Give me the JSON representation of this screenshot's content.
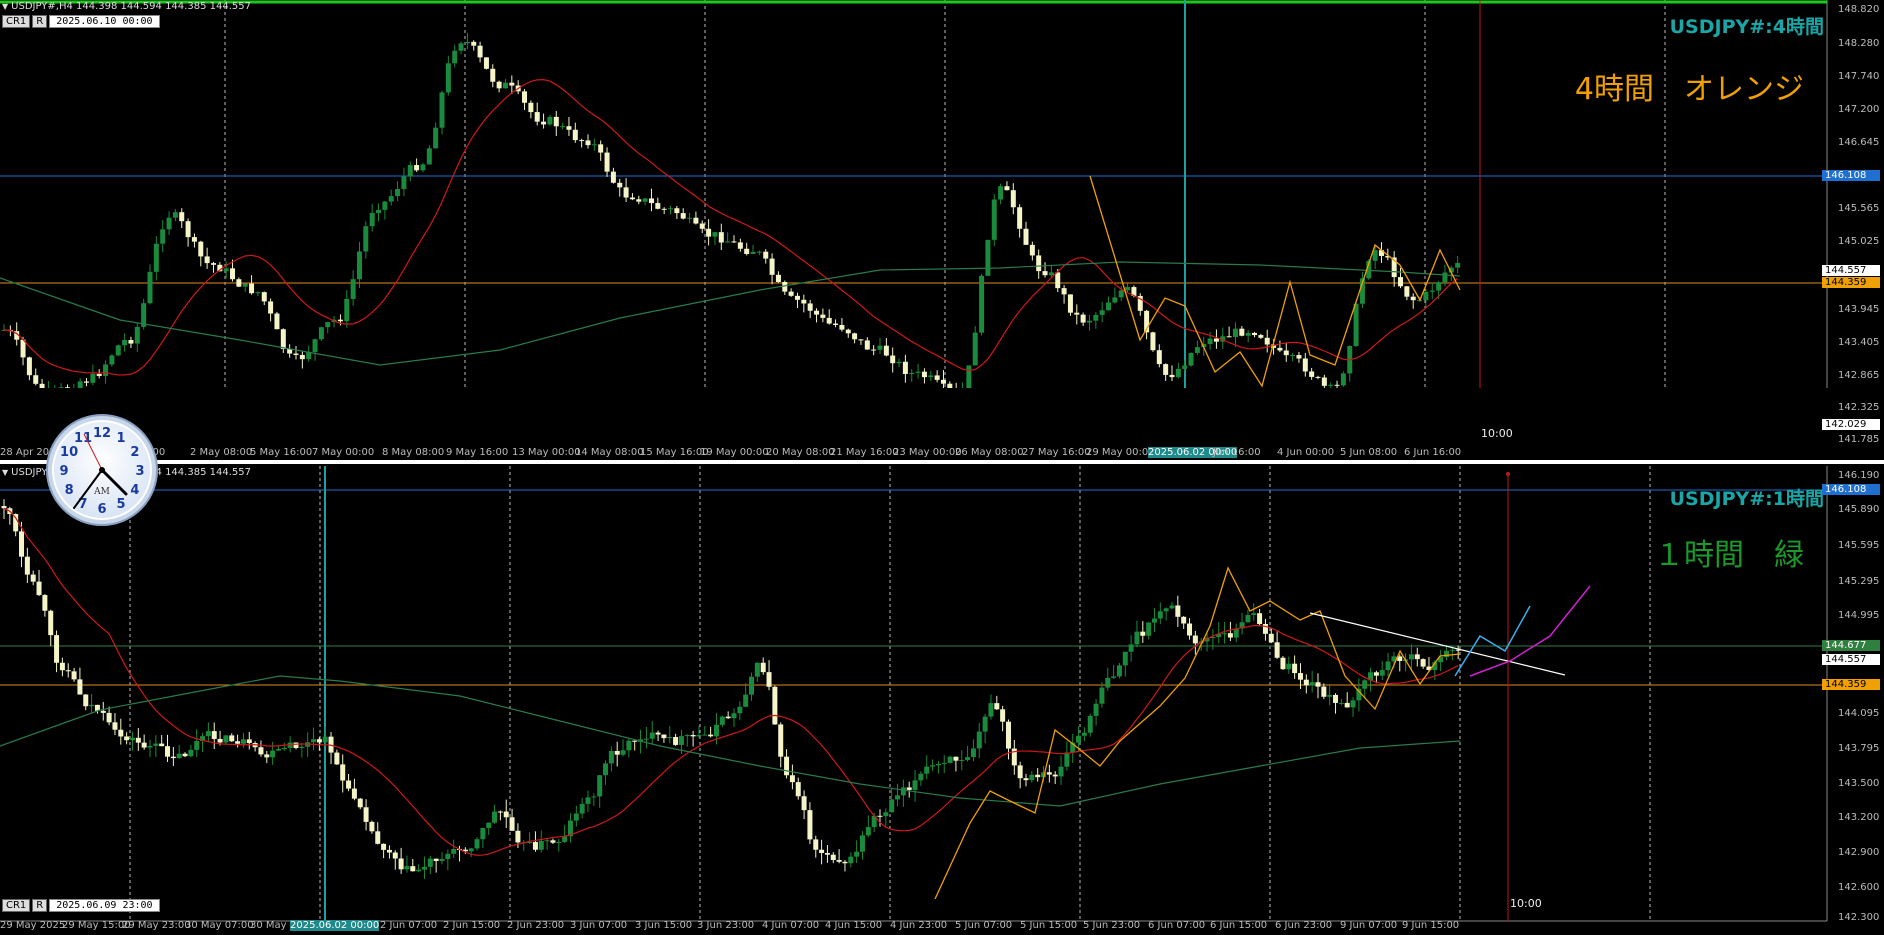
{
  "top": {
    "header": "USDJPY#,H4  144.398 144.594 144.385 144.557",
    "controls": {
      "b1": "CR1",
      "b2": "R",
      "datetime": "2025.06.10 00:00"
    },
    "symbol_label": "USDJPY#:4時間",
    "timeframe_label": "4時間　オレンジ",
    "price_ticks": [
      "148.820",
      "148.280",
      "147.740",
      "147.200",
      "146.645",
      "146.108",
      "145.565",
      "145.025",
      "144.557",
      "144.359",
      "143.945",
      "143.405",
      "142.865",
      "142.325",
      "142.029",
      "141.785"
    ],
    "price_tags": {
      "blue": "146.108",
      "white": "144.557",
      "orange": "144.359",
      "bottom": "142.029"
    },
    "time_labels": [
      "28 Apr 2025",
      "30 Apr 16:00",
      "2 May 08:00",
      "5 May 16:00",
      "7 May 00:00",
      "8 May 08:00",
      "9 May 16:00",
      "13 May 00:00",
      "14 May 08:00",
      "15 May 16:00",
      "19 May 00:00",
      "20 May 08:00",
      "21 May 16:00",
      "23 May 00:00",
      "26 May 08:00",
      "27 May 16:00",
      "29 May 00:00",
      "2025.06.02 00:00",
      "Jun 16:00",
      "4 Jun 00:00",
      "5 Jun 08:00",
      "6 Jun 16:00"
    ],
    "vline_label": "10:00"
  },
  "bottom": {
    "header": "USDJPY#,H1  144.398 144.594 144.385 144.557",
    "controls": {
      "b1": "CR1",
      "b2": "R",
      "datetime": "2025.06.09 23:00"
    },
    "symbol_label": "USDJPY#:1時間",
    "timeframe_label": "１時間　緑",
    "price_ticks": [
      "146.190",
      "146.108",
      "145.890",
      "145.595",
      "145.295",
      "144.995",
      "144.677",
      "144.557",
      "144.359",
      "144.095",
      "143.795",
      "143.500",
      "143.200",
      "142.900",
      "142.600",
      "142.300"
    ],
    "price_tags": {
      "blue": "146.108",
      "green": "144.677",
      "white": "144.557",
      "orange": "144.359"
    },
    "time_labels": [
      "29 May 2025",
      "29 May 15:00",
      "29 May 23:00",
      "30 May 07:00",
      "30 May",
      "2025.06.02 00:00",
      "2 Jun 07:00",
      "2 Jun 15:00",
      "2 Jun 23:00",
      "3 Jun 07:00",
      "3 Jun 15:00",
      "3 Jun 23:00",
      "4 Jun 07:00",
      "4 Jun 15:00",
      "4 Jun 23:00",
      "5 Jun 07:00",
      "5 Jun 15:00",
      "5 Jun 23:00",
      "6 Jun 07:00",
      "6 Jun 15:00",
      "6 Jun 23:00",
      "9 Jun 07:00",
      "9 Jun 15:00"
    ],
    "vline_label": "10:00"
  },
  "clock": {
    "label": "AM",
    "numbers": [
      "12",
      "1",
      "2",
      "3",
      "4",
      "5",
      "6",
      "7",
      "8",
      "9",
      "10",
      "11"
    ]
  },
  "colors": {
    "bull": "#1a8a3c",
    "bear": "#f5f5c8",
    "ma_fast": "#d01818",
    "ma_slow": "#2a7a4a",
    "zigzag": "#f0a000",
    "cyan": "#1ea0a0",
    "blue_line": "#1e6fd0"
  }
}
